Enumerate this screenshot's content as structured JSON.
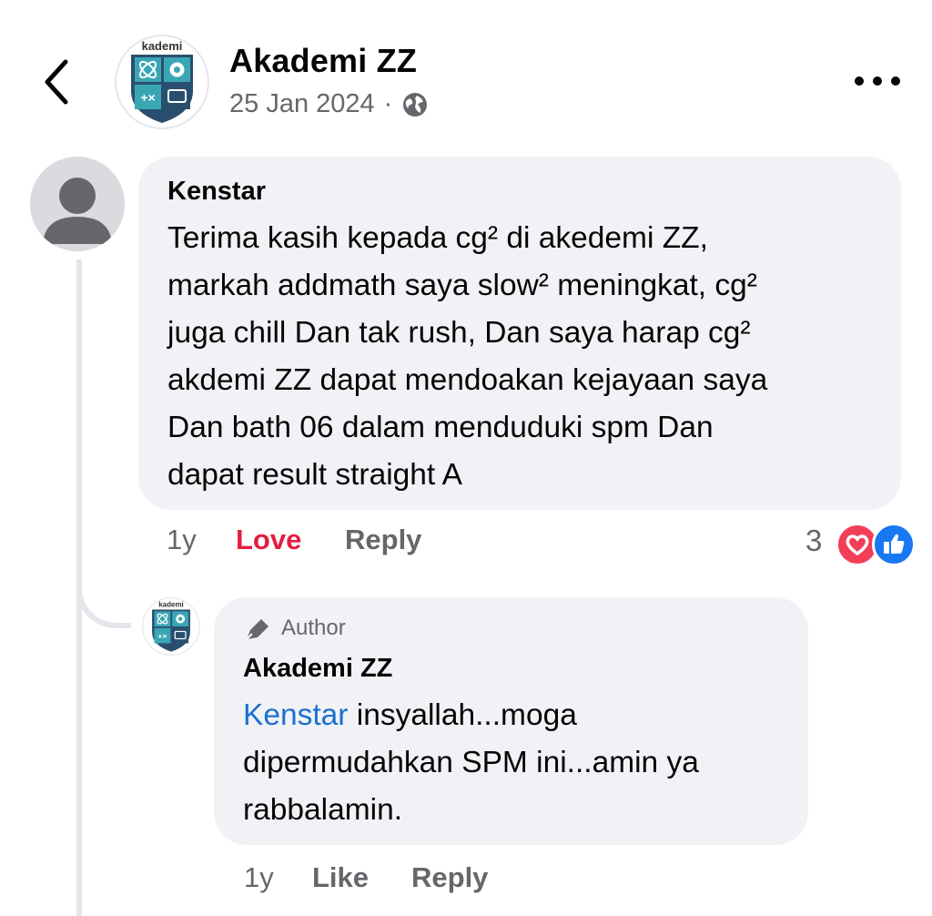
{
  "header": {
    "page_name": "Akademi ZZ",
    "date": "25 Jan 2024",
    "separator": "·",
    "logo_text": "kademi"
  },
  "icons": {
    "back": "chevron-left-icon",
    "more": "more-horizontal-icon",
    "privacy": "globe-icon",
    "author_badge": "pen-icon",
    "reaction_love": "heart-icon",
    "reaction_like": "thumbs-up-icon"
  },
  "colors": {
    "bubble": "#f0f2f5",
    "secondary_text": "#65676b",
    "love": "#e41e3f",
    "mention": "#1c6fd1",
    "like": "#1877f2"
  },
  "comments": [
    {
      "author": "Kenstar",
      "text": "Terima kasih kepada cg² di akedemi ZZ,\nmarkah addmath saya slow² meningkat, cg²\njuga chill Dan tak rush, Dan saya harap cg²\nakdemi ZZ dapat mendoakan kejayaan saya\nDan bath 06 dalam menduduki spm Dan\ndapat result straight A",
      "time": "1y",
      "reaction_label": "Love",
      "reply_label": "Reply",
      "reaction_count": "3"
    },
    {
      "badge": "Author",
      "author": "Akademi ZZ",
      "mention": "Kenstar",
      "text": " insyallah...moga dipermudahkan SPM ini...amin ya rabbalamin.",
      "time": "1y",
      "like_label": "Like",
      "reply_label": "Reply"
    }
  ]
}
